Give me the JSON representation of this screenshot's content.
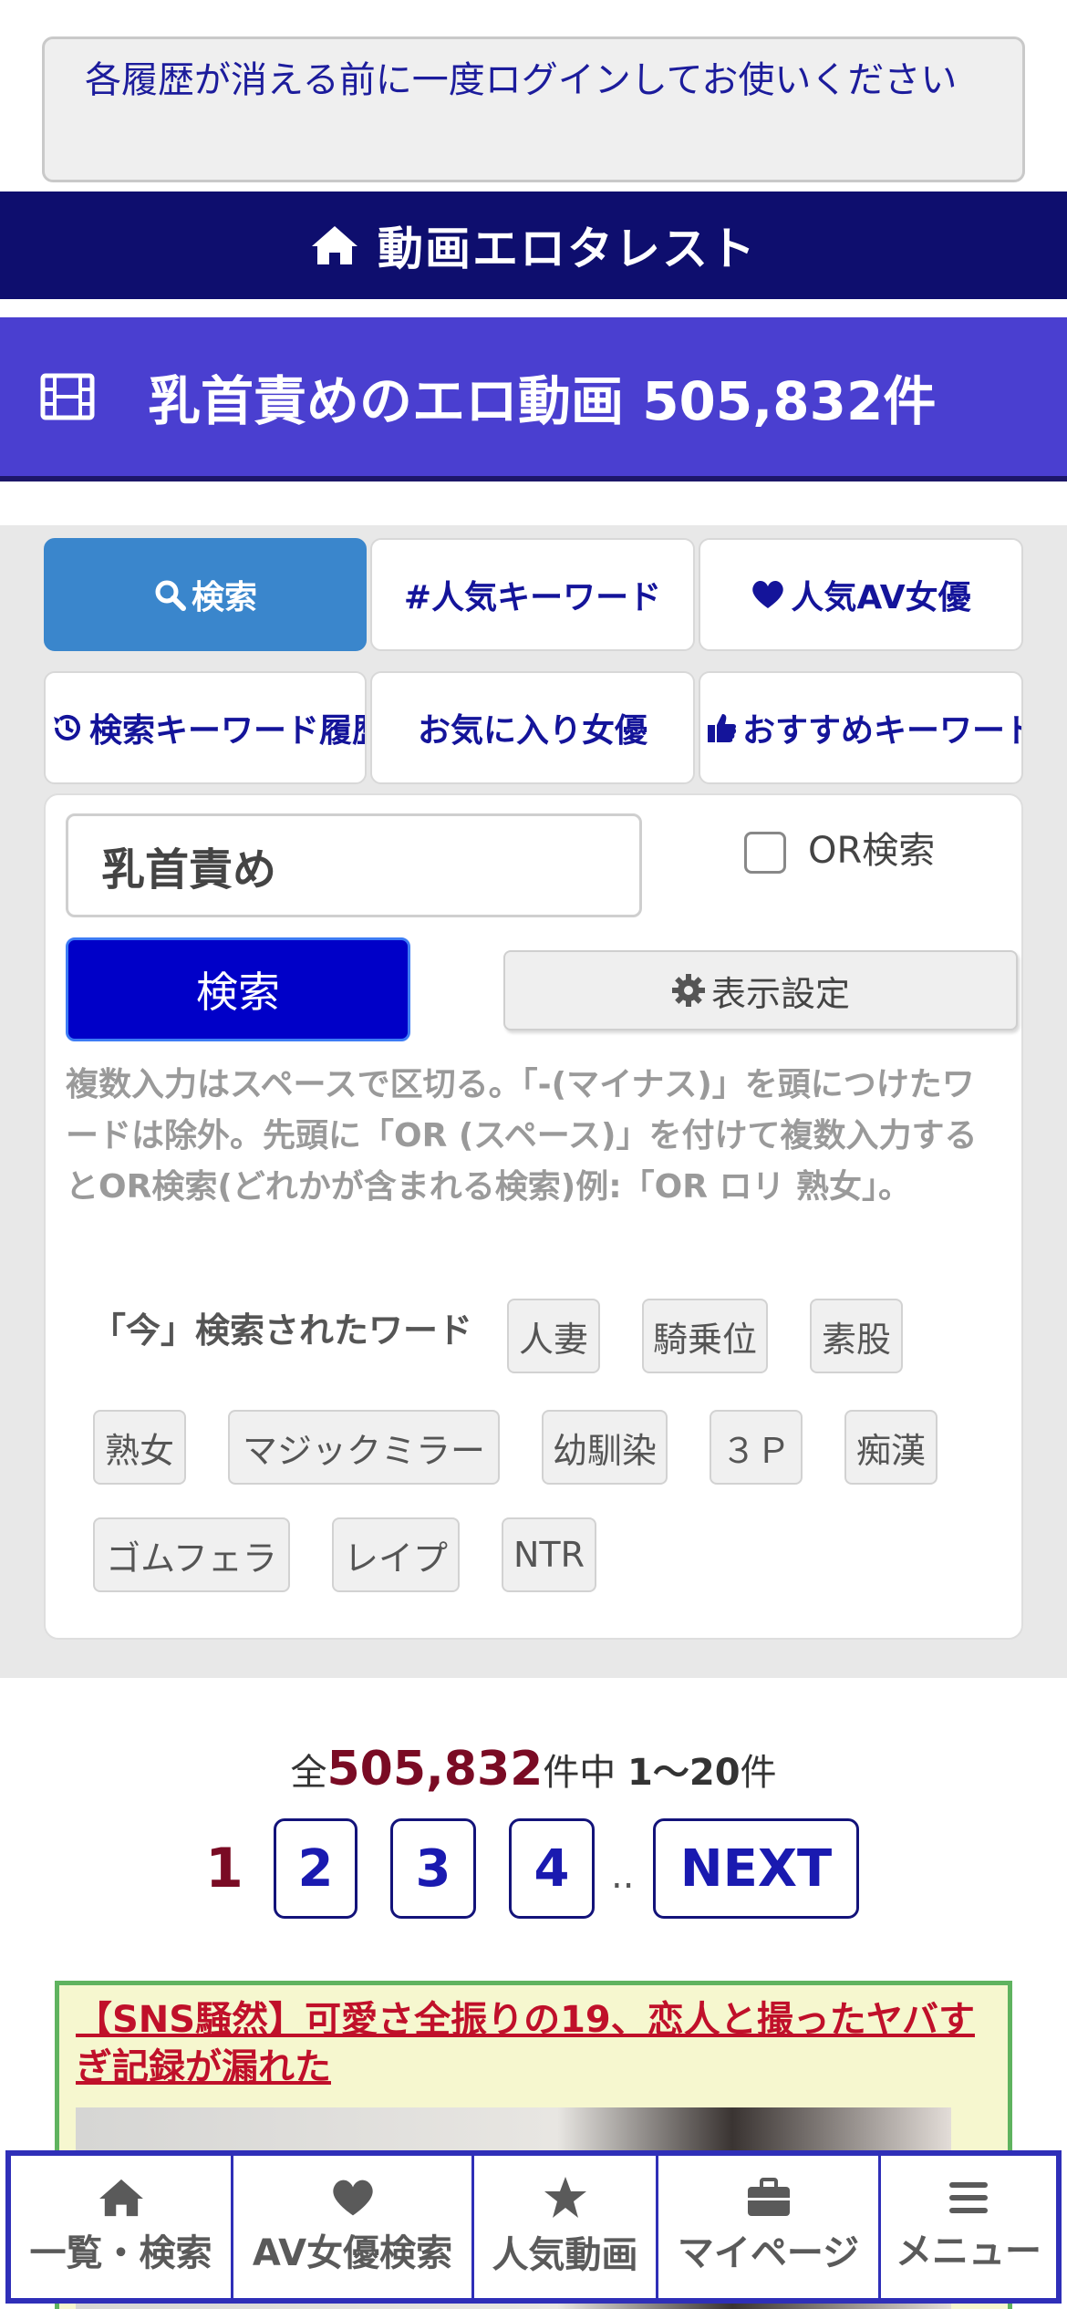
{
  "notice": {
    "text": "各履歴が消える前に一度ログインしてお使いください"
  },
  "header": {
    "site_name": "動画エロタレスト",
    "icon": "home-icon"
  },
  "page_title": {
    "text": "乳首責めのエロ動画 505,832件",
    "icon": "film-icon"
  },
  "tabs": [
    {
      "label": "検索",
      "icon": "search-icon",
      "active": true
    },
    {
      "label": "#人気キーワード",
      "icon": "",
      "active": false
    },
    {
      "label": "人気AV女優",
      "icon": "heart-icon",
      "active": false
    },
    {
      "label": "検索キーワード履歴",
      "icon": "history-icon",
      "active": false
    },
    {
      "label": "お気に入り女優",
      "icon": "",
      "active": false
    },
    {
      "label": "おすすめキーワード",
      "icon": "thumbs-up-icon",
      "active": false
    }
  ],
  "search": {
    "value": "乳首責め",
    "or_label": "OR検索",
    "or_checked": false,
    "submit_label": "検索",
    "settings_label": "表示設定",
    "help_text": "複数入力はスペースで区切る。「-(マイナス)」を頭につけたワードは除外。先頭に「OR (スペース)」を付けて複数入力するとOR検索(どれかが含まれる検索)例:「OR ロリ 熟女」。"
  },
  "trending": {
    "label": "「今」検索されたワード",
    "words": [
      "人妻",
      "騎乗位",
      "素股",
      "熟女",
      "マジックミラー",
      "幼馴染",
      "３Ｐ",
      "痴漢",
      "ゴムフェラ",
      "レイプ",
      "NTR"
    ]
  },
  "results": {
    "prefix": "全",
    "total": "505,832",
    "middle": "件中 ",
    "range": "1〜20",
    "suffix": "件"
  },
  "pagination": {
    "current": "1",
    "pages": [
      "2",
      "3",
      "4"
    ],
    "dots": "..",
    "next": "NEXT"
  },
  "ad": {
    "title": "【SNS騒然】可愛さ全振りの19、恋人と撮ったヤバすぎ記録が漏れた"
  },
  "bottom_nav": [
    {
      "label": "一覧・検索",
      "icon": "home-icon"
    },
    {
      "label": "AV女優検索",
      "icon": "heart-icon"
    },
    {
      "label": "人気動画",
      "icon": "star-icon"
    },
    {
      "label": "マイページ",
      "icon": "briefcase-icon"
    },
    {
      "label": "メニュー",
      "icon": "menu-icon"
    }
  ],
  "colors": {
    "header_bg": "#0e0e6e",
    "title_bg": "#4a3fd0",
    "active_tab": "#3a86cc",
    "search_button": "#0000c8",
    "count_accent": "#7a0b24"
  }
}
